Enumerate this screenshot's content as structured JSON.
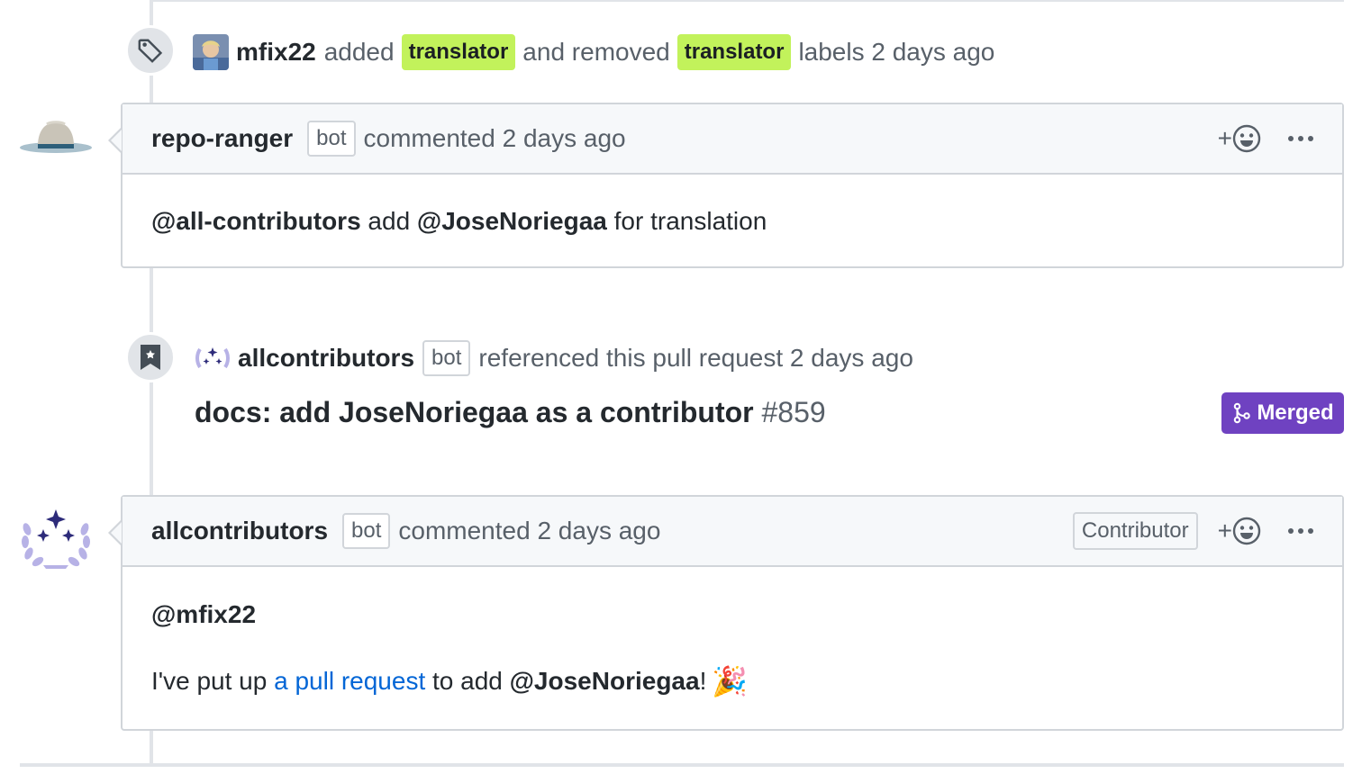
{
  "label_event": {
    "author": "mfix22",
    "added_text": "added",
    "label_added": "translator",
    "removed_text": "and removed",
    "label_removed": "translator",
    "suffix": "labels 2 days ago",
    "icon": "tag-icon"
  },
  "comment1": {
    "author": "repo-ranger",
    "bot": "bot",
    "meta": "commented 2 days ago",
    "react": "+",
    "body": {
      "mention1": "@all-contributors",
      "text1": " add ",
      "mention2": "@JoseNoriegaa",
      "text2": " for translation"
    }
  },
  "ref_event": {
    "author": "allcontributors",
    "bot": "bot",
    "meta": "referenced this pull request 2 days ago",
    "title": "docs: add JoseNoriegaa as a contributor",
    "number": "#859",
    "state": "Merged",
    "icon": "bookmark-icon",
    "state_color": "#6f42c1"
  },
  "comment2": {
    "author": "allcontributors",
    "bot": "bot",
    "meta": "commented 2 days ago",
    "role": "Contributor",
    "react": "+",
    "body": {
      "mention": "@mfix22",
      "text1": "I've put up ",
      "link": "a pull request",
      "text2": " to add ",
      "mention2": "@JoseNoriegaa",
      "text3": "!",
      "emoji": "🎉"
    }
  },
  "colors": {
    "label_bg": "#c2f25b",
    "link": "#0366d6",
    "merged": "#6f42c1"
  }
}
